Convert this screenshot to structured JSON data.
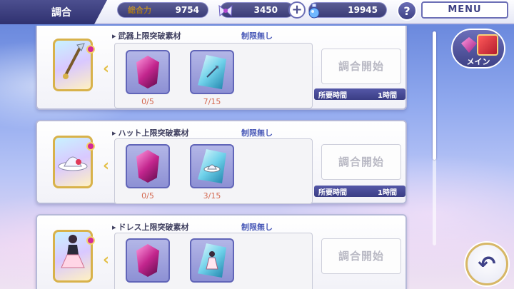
{
  "header": {
    "title": "調合",
    "power_label": "総合力",
    "power_value": "9754",
    "currency1_value": "3450",
    "currency2_value": "19945",
    "plus_label": "+",
    "help_label": "?",
    "menu_label": "MENU"
  },
  "side": {
    "main_label": "メイン",
    "back_label": "↶"
  },
  "rows": [
    {
      "material_title": "武器上限突破素材",
      "limit_text": "制限無し",
      "slot1_count": "0/5",
      "slot2_count": "7/15",
      "start_label": "調合開始",
      "time_label": "所要時間",
      "time_value": "1時間"
    },
    {
      "material_title": "ハット上限突破素材",
      "limit_text": "制限無し",
      "slot1_count": "0/5",
      "slot2_count": "3/15",
      "start_label": "調合開始",
      "time_label": "所要時間",
      "time_value": "1時間"
    },
    {
      "material_title": "ドレス上限突破素材",
      "limit_text": "制限無し",
      "start_label": "調合開始"
    }
  ],
  "colors": {
    "accent": "#3f4287",
    "limit_text": "#4a5ab8",
    "count_text": "#d46a52",
    "gold_frame": "#d8b24a"
  },
  "icons": [
    "sword-icon",
    "hat-icon",
    "dress-icon",
    "pink-crystal-icon",
    "blue-crystal-icon",
    "back-arrow-icon",
    "book-icon"
  ]
}
